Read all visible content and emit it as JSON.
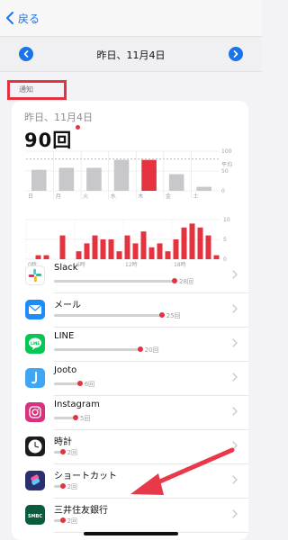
{
  "nav": {
    "back_label": "戻る"
  },
  "date_bar": {
    "title": "昨日、11月4日"
  },
  "notice_label": "通知",
  "summary": {
    "day_label": "昨日、11月4日",
    "total": "90回"
  },
  "weekly": {
    "days": [
      "日",
      "月",
      "火",
      "水",
      "木",
      "金",
      "土"
    ],
    "values": [
      53,
      58,
      58,
      78,
      78,
      42,
      10
    ],
    "highlight_index": 4,
    "ylim": [
      0,
      100
    ],
    "y_ticks": [
      "100",
      "平均",
      "50",
      "0"
    ],
    "average": 80
  },
  "hourly": {
    "x_labels": [
      "0時",
      "6時",
      "12時",
      "18時"
    ],
    "y_ticks": [
      "10",
      "5",
      "0"
    ],
    "ylim": [
      0,
      10
    ],
    "values": [
      0,
      1,
      1,
      0,
      6,
      0,
      2,
      4,
      6,
      5,
      5,
      2,
      6,
      4,
      7,
      3,
      4,
      2,
      5,
      8,
      9,
      8,
      6,
      1
    ]
  },
  "chart_data": [
    {
      "type": "bar",
      "title": "",
      "categories": [
        "日",
        "月",
        "火",
        "水",
        "木",
        "金",
        "土"
      ],
      "values": [
        53,
        58,
        58,
        78,
        78,
        42,
        10
      ],
      "ylim": [
        0,
        100
      ],
      "xlabel": "",
      "ylabel": ""
    },
    {
      "type": "bar",
      "title": "",
      "categories": [
        "0時",
        "1",
        "2",
        "3",
        "4",
        "5",
        "6時",
        "7",
        "8",
        "9",
        "10",
        "11",
        "12時",
        "13",
        "14",
        "15",
        "16",
        "17",
        "18時",
        "19",
        "20",
        "21",
        "22",
        "23"
      ],
      "values": [
        0,
        1,
        1,
        0,
        6,
        0,
        2,
        4,
        6,
        5,
        5,
        2,
        6,
        4,
        7,
        3,
        4,
        2,
        5,
        8,
        9,
        8,
        6,
        1
      ],
      "ylim": [
        0,
        10
      ],
      "xlabel": "",
      "ylabel": ""
    }
  ],
  "apps": [
    {
      "name": "Slack",
      "count": "28回",
      "value": 28,
      "icon": "slack-icon",
      "color": "#ffffff"
    },
    {
      "name": "メール",
      "count": "25回",
      "value": 25,
      "icon": "mail-icon",
      "color": "#1d8cf8"
    },
    {
      "name": "LINE",
      "count": "20回",
      "value": 20,
      "icon": "line-icon",
      "color": "#06c755"
    },
    {
      "name": "Jooto",
      "count": "6回",
      "value": 6,
      "icon": "jooto-icon",
      "color": "#3fa5f5"
    },
    {
      "name": "Instagram",
      "count": "5回",
      "value": 5,
      "icon": "instagram-icon",
      "color": "#d6327e"
    },
    {
      "name": "時計",
      "count": "2回",
      "value": 2,
      "icon": "clock-icon",
      "color": "#1c1c1e"
    },
    {
      "name": "ショートカット",
      "count": "2回",
      "value": 2,
      "icon": "shortcuts-icon",
      "color": "#2b2f6d"
    },
    {
      "name": "三井住友銀行",
      "count": "2回",
      "value": 2,
      "icon": "smbc-icon",
      "color": "#0a5c3c"
    }
  ],
  "colors": {
    "accent": "#1a73e8",
    "highlight": "#e5323f",
    "bar_gray": "#c7c7cc",
    "annotation": "#e5323f"
  }
}
